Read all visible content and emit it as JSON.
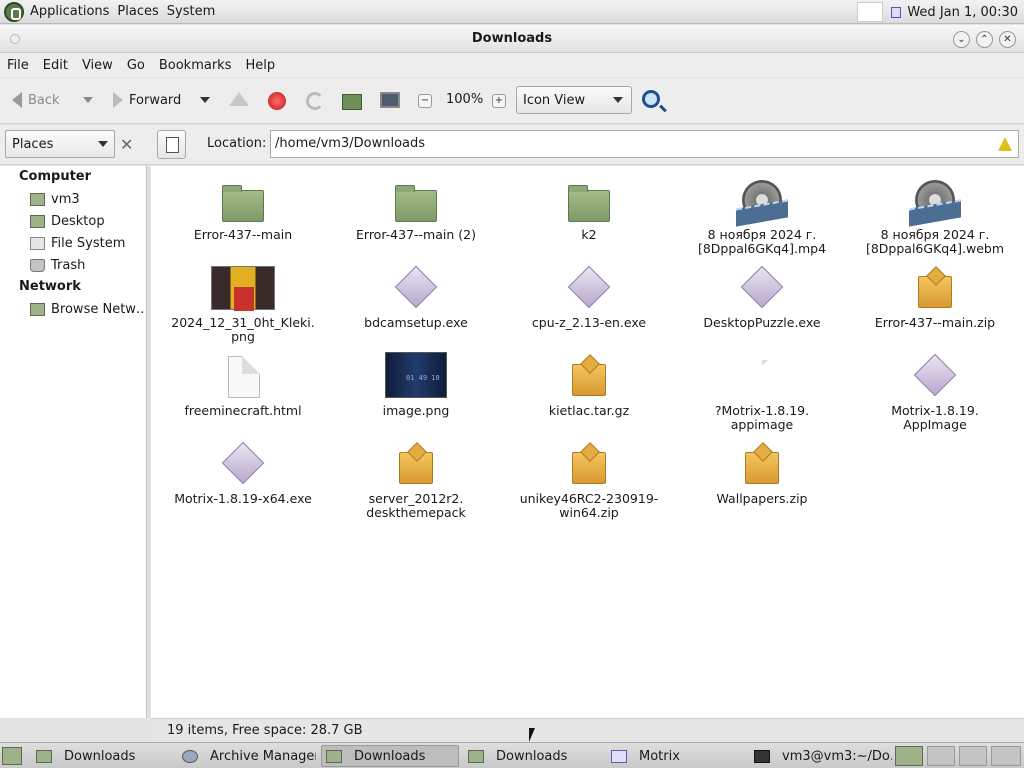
{
  "top_panel": {
    "menus": [
      "Applications",
      "Places",
      "System"
    ],
    "clock": "Wed Jan  1, 00:30"
  },
  "window": {
    "title": "Downloads"
  },
  "menubar": [
    "File",
    "Edit",
    "View",
    "Go",
    "Bookmarks",
    "Help"
  ],
  "toolbar": {
    "back_label": "Back",
    "forward_label": "Forward",
    "zoom_level": "100%",
    "view_mode": "Icon View"
  },
  "location_bar": {
    "sidebar_select": "Places",
    "label": "Location:",
    "path": "/home/vm3/Downloads"
  },
  "sidebar": {
    "sections": [
      {
        "header": "Computer",
        "items": [
          "vm3",
          "Desktop",
          "File System",
          "Trash"
        ]
      },
      {
        "header": "Network",
        "items": [
          "Browse Netw…"
        ]
      }
    ]
  },
  "files": [
    {
      "name": "Error-437--main",
      "type": "folder-icon"
    },
    {
      "name": "Error-437--main (2)",
      "type": "folder-icon"
    },
    {
      "name": "k2",
      "type": "folder-icon"
    },
    {
      "name": "8 ноября 2024 г.\n[8Dppal6GKq4].mp4",
      "type": "video-icon"
    },
    {
      "name": "8 ноября 2024 г.\n[8Dppal6GKq4].webm",
      "type": "video-icon"
    },
    {
      "name": "2024_12_31_0ht_Kleki.\npng",
      "type": "image-thumbnail"
    },
    {
      "name": "bdcamsetup.exe",
      "type": "executable-icon"
    },
    {
      "name": "cpu-z_2.13-en.exe",
      "type": "executable-icon"
    },
    {
      "name": "DesktopPuzzle.exe",
      "type": "executable-icon"
    },
    {
      "name": "Error-437--main.zip",
      "type": "archive-icon"
    },
    {
      "name": "freeminecraft.html",
      "type": "document-icon"
    },
    {
      "name": "image.png",
      "type": "image-thumbnail"
    },
    {
      "name": "kietlac.tar.gz",
      "type": "archive-icon"
    },
    {
      "name": "?Motrix-1.8.19.\nappimage",
      "type": "broken-file-icon"
    },
    {
      "name": "Motrix-1.8.19.\nAppImage",
      "type": "executable-icon"
    },
    {
      "name": "Motrix-1.8.19-x64.exe",
      "type": "executable-icon"
    },
    {
      "name": "server_2012r2.\ndeskthemepack",
      "type": "archive-icon"
    },
    {
      "name": "unikey46RC2-230919-\nwin64.zip",
      "type": "archive-icon"
    },
    {
      "name": "Wallpapers.zip",
      "type": "archive-icon"
    }
  ],
  "status": "19 items, Free space: 28.7 GB",
  "taskbar": {
    "tasks": [
      {
        "label": "Downloads",
        "icon": "folder-icon"
      },
      {
        "label": "Archive Manager",
        "icon": "archive-manager-icon"
      },
      {
        "label": "Downloads",
        "icon": "folder-icon"
      },
      {
        "label": "Downloads",
        "icon": "folder-icon"
      },
      {
        "label": "Motrix",
        "icon": "motrix-icon"
      },
      {
        "label": "vm3@vm3:~/Do…",
        "icon": "terminal-icon"
      }
    ]
  }
}
